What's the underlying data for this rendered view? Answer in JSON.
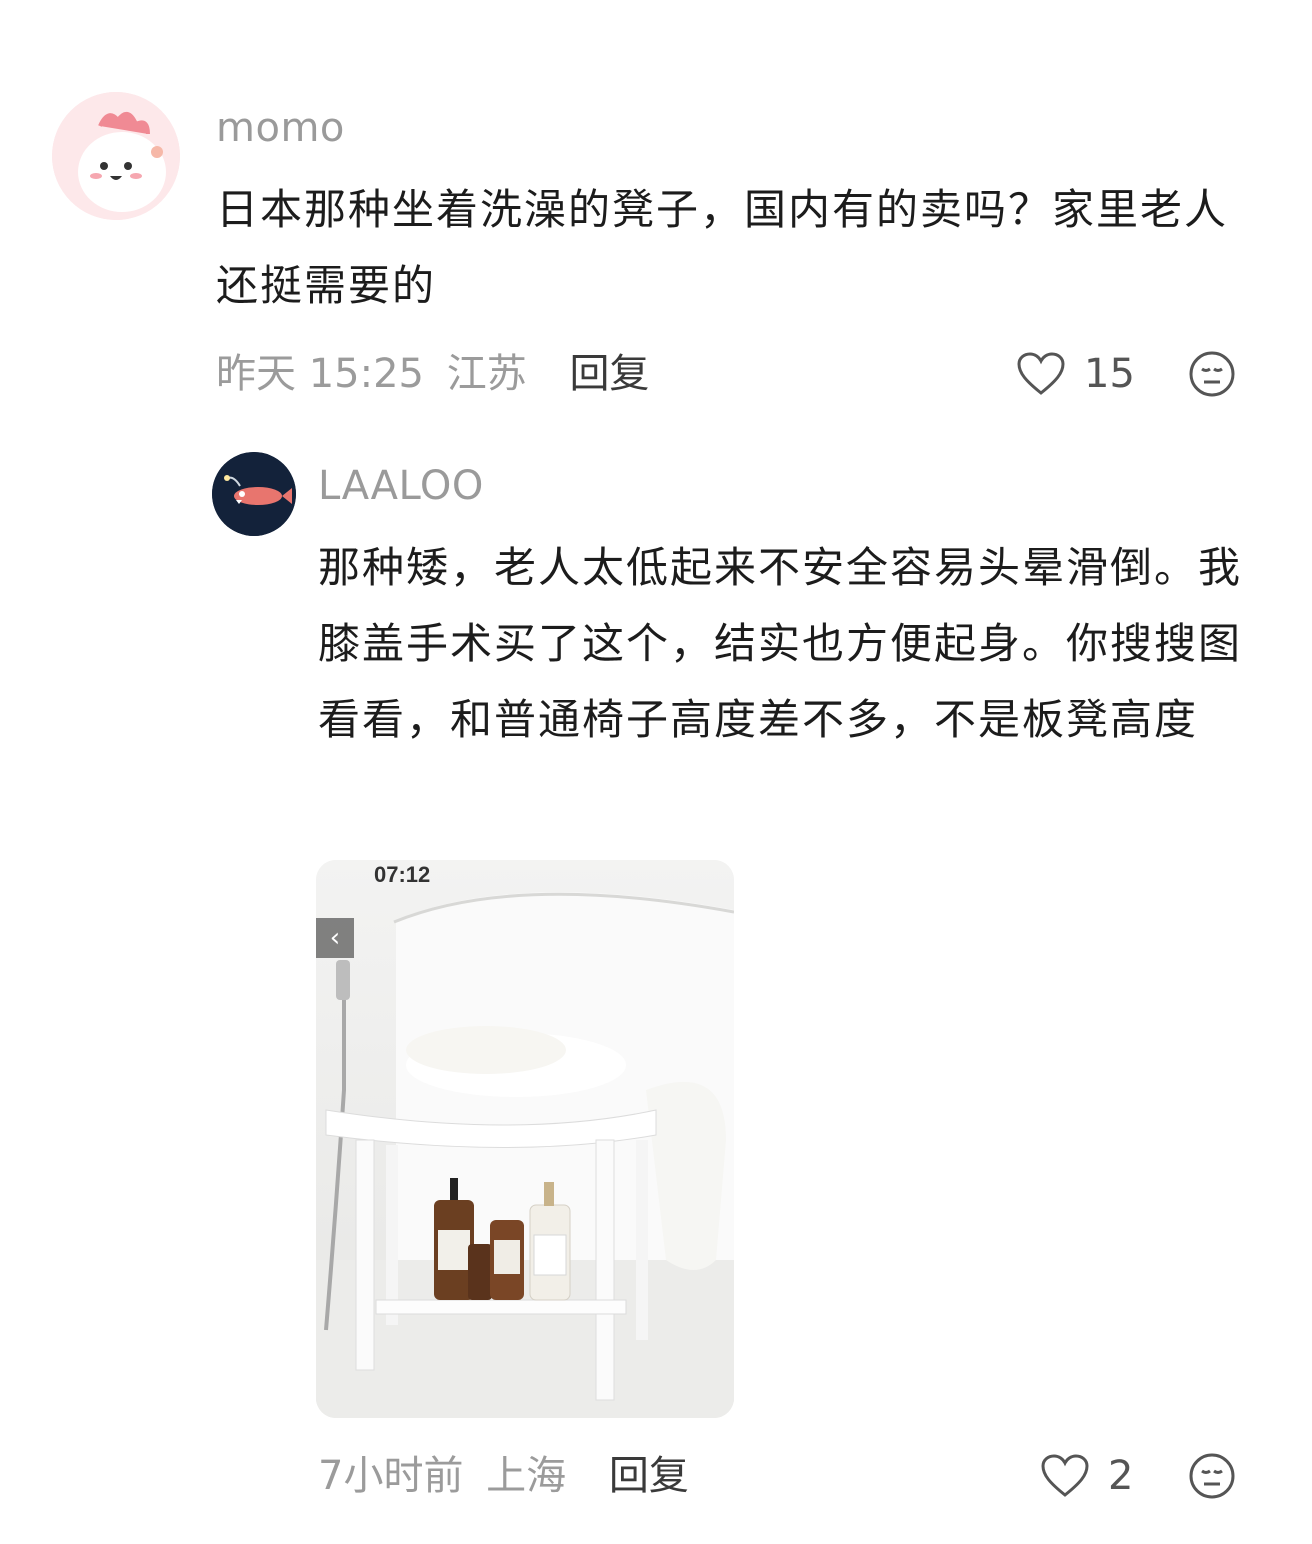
{
  "comments": [
    {
      "username": "momo",
      "avatar_icon": "pink-cartoon-avatar",
      "content": "日本那种坐着洗澡的凳子，国内有的卖吗？家里老人还挺需要的",
      "time": "昨天 15:25",
      "location": "江苏",
      "reply_label": "回复",
      "likes": "15"
    },
    {
      "username": "LAALOO",
      "avatar_icon": "anglerfish-avatar",
      "content": "那种矮，老人太低起来不安全容易头晕滑倒。我膝盖手术买了这个，结实也方便起身。你搜搜图看看，和普通椅子高度差不多，不是板凳高度",
      "image": {
        "timestamp": "07:12",
        "back_icon": "‹"
      },
      "time": "7小时前",
      "location": "上海",
      "reply_label": "回复",
      "likes": "2"
    }
  ],
  "colors": {
    "meta": "#9b9b9b",
    "text": "#1c1c1c",
    "reply": "#3a3a3a"
  }
}
